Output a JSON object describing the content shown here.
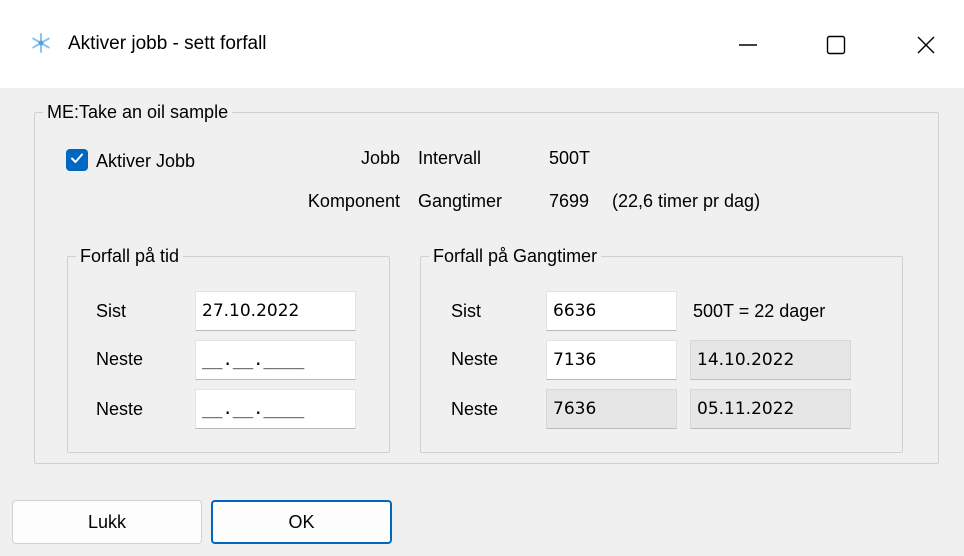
{
  "window": {
    "title": "Aktiver jobb - sett forfall",
    "icons": {
      "app": "snowflake-icon",
      "minimize": "minimize-icon",
      "maximize": "maximize-icon",
      "close": "close-icon"
    }
  },
  "main_group": {
    "title": "ME:Take an oil sample",
    "activate_checkbox": {
      "label": "Aktiver Jobb",
      "checked": true
    },
    "info": [
      {
        "key": "Jobb",
        "field": "Intervall",
        "value": "500T",
        "extra": ""
      },
      {
        "key": "Komponent",
        "field": "Gangtimer",
        "value": "7699",
        "extra": "(22,6 timer pr dag)"
      }
    ]
  },
  "time_group": {
    "title": "Forfall på tid",
    "rows": [
      {
        "label": "Sist",
        "value": "27.10.2022"
      },
      {
        "label": "Neste",
        "value": "__.__.____"
      },
      {
        "label": "Neste",
        "value": "__.__.____"
      }
    ]
  },
  "hours_group": {
    "title": "Forfall på Gangtimer",
    "rows": [
      {
        "label": "Sist",
        "value": "6636",
        "extra": "500T = 22 dager"
      },
      {
        "label": "Neste",
        "value": "7136",
        "date": "14.10.2022"
      },
      {
        "label": "Neste",
        "value": "7636",
        "date": "05.11.2022"
      }
    ]
  },
  "buttons": {
    "close_label": "Lukk",
    "ok_label": "OK"
  },
  "colors": {
    "accent": "#0067c0",
    "background": "#f0f0f0",
    "readonly_field": "#e6e6e6"
  }
}
